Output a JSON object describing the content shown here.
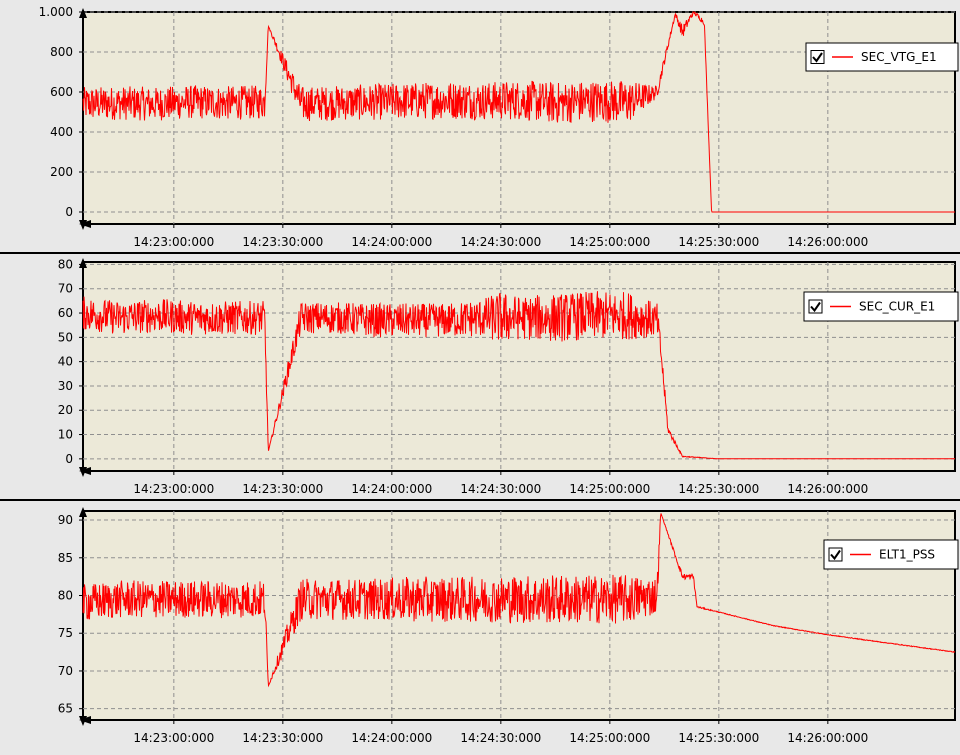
{
  "colors": {
    "series": "#ff0000",
    "plot_bg": "#ece9d8",
    "grid": "#8f8f8f",
    "frame": "#000000",
    "app_bg": "#e8e8e8"
  },
  "icons": [
    "legend-checkbox-icon",
    "axis-arrow-icon"
  ],
  "chart_data": [
    {
      "type": "line",
      "title": "",
      "xlabel": "",
      "ylabel": "",
      "ylim": [
        -60,
        1000
      ],
      "yticks": [
        0,
        200,
        400,
        600,
        800,
        1000
      ],
      "yticklabels": [
        "0",
        "200",
        "400",
        "600",
        "800",
        "1.000"
      ],
      "xlim": [
        "14:22:35",
        "14:26:35"
      ],
      "xticklabels": [
        "14:23:00:000",
        "14:23:30:000",
        "14:24:00:000",
        "14:24:30:000",
        "14:25:00:000",
        "14:25:30:000",
        "14:26:00:000"
      ],
      "grid": true,
      "legend_position": "top-right",
      "series": [
        {
          "name": "SEC_VTG_E1",
          "checked": true,
          "x": [
            "14:22:35",
            "14:22:45",
            "14:22:55",
            "14:23:05",
            "14:23:15",
            "14:23:25",
            "14:23:26",
            "14:23:35",
            "14:23:45",
            "14:23:55",
            "14:24:05",
            "14:24:15",
            "14:24:25",
            "14:24:35",
            "14:24:45",
            "14:24:55",
            "14:25:05",
            "14:25:13",
            "14:25:18",
            "14:25:20",
            "14:25:23",
            "14:25:26",
            "14:25:28",
            "14:25:40",
            "14:26:00",
            "14:26:35"
          ],
          "y": [
            540,
            545,
            540,
            550,
            545,
            550,
            930,
            540,
            545,
            550,
            555,
            560,
            555,
            560,
            545,
            555,
            550,
            600,
            990,
            900,
            1000,
            950,
            0,
            0,
            0,
            0
          ],
          "spread": [
            170,
            170,
            170,
            170,
            170,
            170,
            0,
            175,
            175,
            180,
            185,
            190,
            190,
            200,
            210,
            210,
            220,
            60,
            20,
            70,
            20,
            30,
            0,
            0,
            0,
            0
          ]
        }
      ]
    },
    {
      "type": "line",
      "title": "",
      "xlabel": "",
      "ylabel": "",
      "ylim": [
        -5,
        81
      ],
      "yticks": [
        0,
        10,
        20,
        30,
        40,
        50,
        60,
        70,
        80
      ],
      "yticklabels": [
        "0",
        "10",
        "20",
        "30",
        "40",
        "50",
        "60",
        "70",
        "80"
      ],
      "xlim": [
        "14:22:35",
        "14:26:35"
      ],
      "xticklabels": [
        "14:23:00:000",
        "14:23:30:000",
        "14:24:00:000",
        "14:24:30:000",
        "14:25:00:000",
        "14:25:30:000",
        "14:26:00:000"
      ],
      "grid": true,
      "legend_position": "top-right",
      "series": [
        {
          "name": "SEC_CUR_E1",
          "checked": true,
          "x": [
            "14:22:35",
            "14:22:45",
            "14:22:55",
            "14:23:05",
            "14:23:15",
            "14:23:25",
            "14:23:26",
            "14:23:35",
            "14:23:45",
            "14:23:55",
            "14:24:05",
            "14:24:15",
            "14:24:25",
            "14:24:30",
            "14:24:35",
            "14:24:45",
            "14:24:55",
            "14:25:05",
            "14:25:13",
            "14:25:14",
            "14:25:16",
            "14:25:20",
            "14:25:30",
            "14:26:00",
            "14:26:35"
          ],
          "y": [
            60,
            58,
            59,
            58,
            58,
            58,
            3,
            58,
            58,
            57,
            57,
            57,
            58,
            58,
            58,
            58,
            59,
            59,
            57,
            45,
            12,
            1,
            0,
            0,
            0
          ],
          "spread": [
            14,
            14,
            14,
            14,
            14,
            14,
            0,
            13,
            13,
            14,
            14,
            14,
            16,
            22,
            18,
            20,
            20,
            20,
            14,
            10,
            3,
            0.5,
            0,
            0,
            0
          ]
        }
      ]
    },
    {
      "type": "line",
      "title": "",
      "xlabel": "",
      "ylabel": "",
      "ylim": [
        63.5,
        91.2
      ],
      "yticks": [
        65,
        70,
        75,
        80,
        85,
        90
      ],
      "yticklabels": [
        "65",
        "70",
        "75",
        "80",
        "85",
        "90"
      ],
      "xlim": [
        "14:22:35",
        "14:26:35"
      ],
      "xticklabels": [
        "14:23:00:000",
        "14:23:30:000",
        "14:24:00:000",
        "14:24:30:000",
        "14:25:00:000",
        "14:25:30:000",
        "14:26:00:000"
      ],
      "grid": true,
      "legend_position": "top-right",
      "series": [
        {
          "name": "ELT1_PSS",
          "checked": true,
          "x": [
            "14:22:35",
            "14:22:45",
            "14:22:55",
            "14:23:05",
            "14:23:15",
            "14:23:25",
            "14:23:26",
            "14:23:35",
            "14:23:45",
            "14:23:55",
            "14:24:05",
            "14:24:15",
            "14:24:25",
            "14:24:35",
            "14:24:45",
            "14:24:55",
            "14:25:05",
            "14:25:13",
            "14:25:14",
            "14:25:20",
            "14:25:23",
            "14:25:24",
            "14:25:30",
            "14:25:45",
            "14:26:00",
            "14:26:15",
            "14:26:35"
          ],
          "y": [
            79,
            79.5,
            79.5,
            79.5,
            79.5,
            79.5,
            68,
            79.5,
            79.5,
            79.5,
            79.5,
            79.5,
            79.5,
            79.5,
            79.5,
            79.5,
            79.5,
            80,
            91,
            82.5,
            82.5,
            78.5,
            77.8,
            76,
            74.8,
            73.8,
            72.5
          ],
          "spread": [
            5,
            5,
            5,
            5,
            5,
            5,
            0,
            5.5,
            5.5,
            5.5,
            6,
            6,
            6,
            6.5,
            6.5,
            6.5,
            6.5,
            5,
            0,
            0.8,
            0.8,
            0.2,
            0.1,
            0.1,
            0.1,
            0.1,
            0.1
          ]
        }
      ]
    }
  ]
}
